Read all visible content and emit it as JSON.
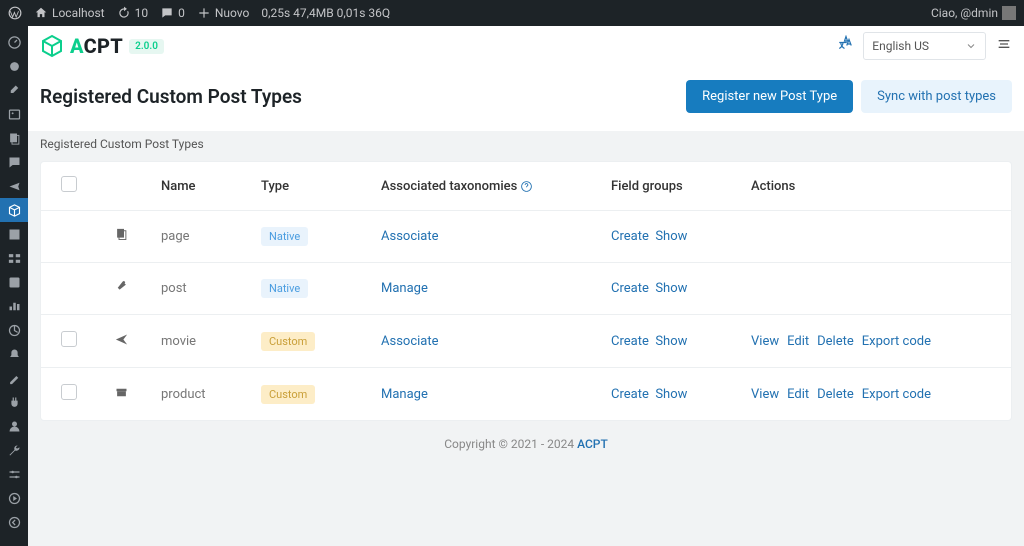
{
  "adminbar": {
    "site": "Localhost",
    "updates": "10",
    "comments": "0",
    "new": "Nuovo",
    "debug": "0,25s 47,4MB 0,01s 36Q",
    "greeting": "Ciao, @dmin"
  },
  "header": {
    "logo_a": "A",
    "logo_rest": "CPT",
    "version": "2.0.0",
    "lang_selected": "English US"
  },
  "page": {
    "title": "Registered Custom Post Types",
    "btn_register": "Register new Post Type",
    "btn_sync": "Sync with post types",
    "subheading": "Registered Custom Post Types"
  },
  "table": {
    "headers": {
      "name": "Name",
      "type": "Type",
      "assoc_tax": "Associated taxonomies",
      "field_groups": "Field groups",
      "actions": "Actions"
    },
    "labels": {
      "native": "Native",
      "custom": "Custom",
      "associate": "Associate",
      "manage": "Manage",
      "create": "Create",
      "show": "Show",
      "view": "View",
      "edit": "Edit",
      "delete": "Delete",
      "export": "Export code"
    },
    "rows": [
      {
        "name": "page"
      },
      {
        "name": "post"
      },
      {
        "name": "movie"
      },
      {
        "name": "product"
      }
    ]
  },
  "footer": {
    "copyright": "Copyright © 2021 - 2024 ",
    "link": "ACPT"
  }
}
